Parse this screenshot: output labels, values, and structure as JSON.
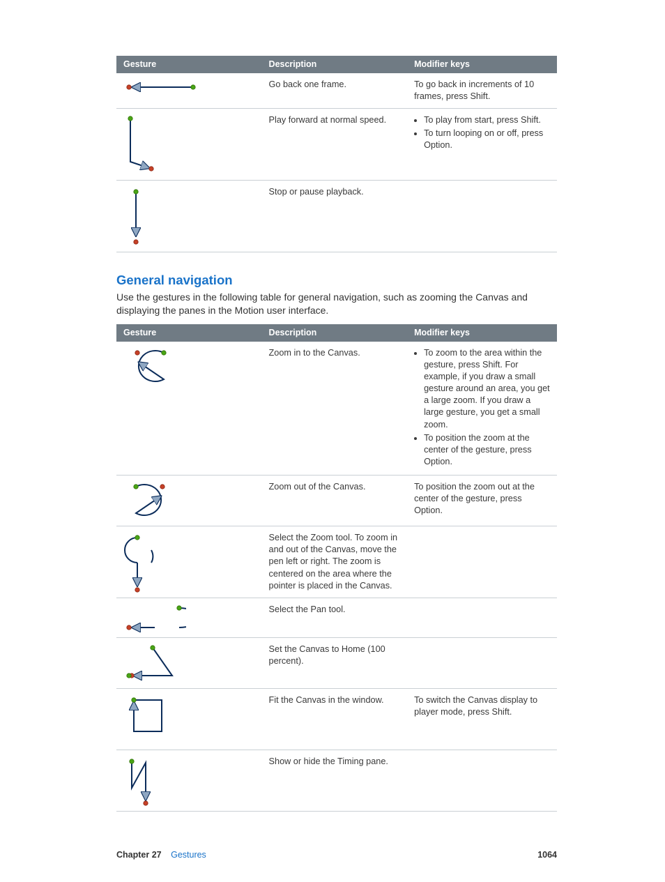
{
  "tables": {
    "top": {
      "headers": [
        "Gesture",
        "Description",
        "Modifier keys"
      ],
      "rows": [
        {
          "description": "Go back one frame.",
          "modifier_text": "To go back in increments of 10 frames, press Shift."
        },
        {
          "description": "Play forward at normal speed.",
          "modifier_list": [
            "To play from start, press Shift.",
            "To turn looping on or off, press Option."
          ]
        },
        {
          "description": "Stop or pause playback.",
          "modifier_text": ""
        }
      ]
    },
    "nav": {
      "headers": [
        "Gesture",
        "Description",
        "Modifier keys"
      ],
      "rows": [
        {
          "description": "Zoom in to the Canvas.",
          "modifier_list": [
            "To zoom to the area within the gesture, press Shift. For example, if you draw a small gesture around an area, you get a large zoom. If you draw a large gesture, you get a small zoom.",
            "To position the zoom at the center of the gesture, press Option."
          ]
        },
        {
          "description": "Zoom out of the Canvas.",
          "modifier_text": "To position the zoom out at the center of the gesture, press Option."
        },
        {
          "description": "Select the Zoom tool. To zoom in and out of the Canvas, move the pen left or right. The zoom is centered on the area where the pointer is placed in the Canvas.",
          "modifier_text": ""
        },
        {
          "description": "Select the Pan tool.",
          "modifier_text": ""
        },
        {
          "description": "Set the Canvas to Home (100 percent).",
          "modifier_text": ""
        },
        {
          "description": "Fit the Canvas in the window.",
          "modifier_text": "To switch the Canvas display to player mode, press Shift."
        },
        {
          "description": "Show or hide the Timing pane.",
          "modifier_text": ""
        }
      ]
    }
  },
  "section": {
    "title": "General navigation",
    "intro": "Use the gestures in the following table for general navigation, such as zooming the Canvas and displaying the panes in the Motion user interface."
  },
  "footer": {
    "chapter_label": "Chapter 27",
    "chapter_name": "Gestures",
    "page_number": "1064"
  }
}
